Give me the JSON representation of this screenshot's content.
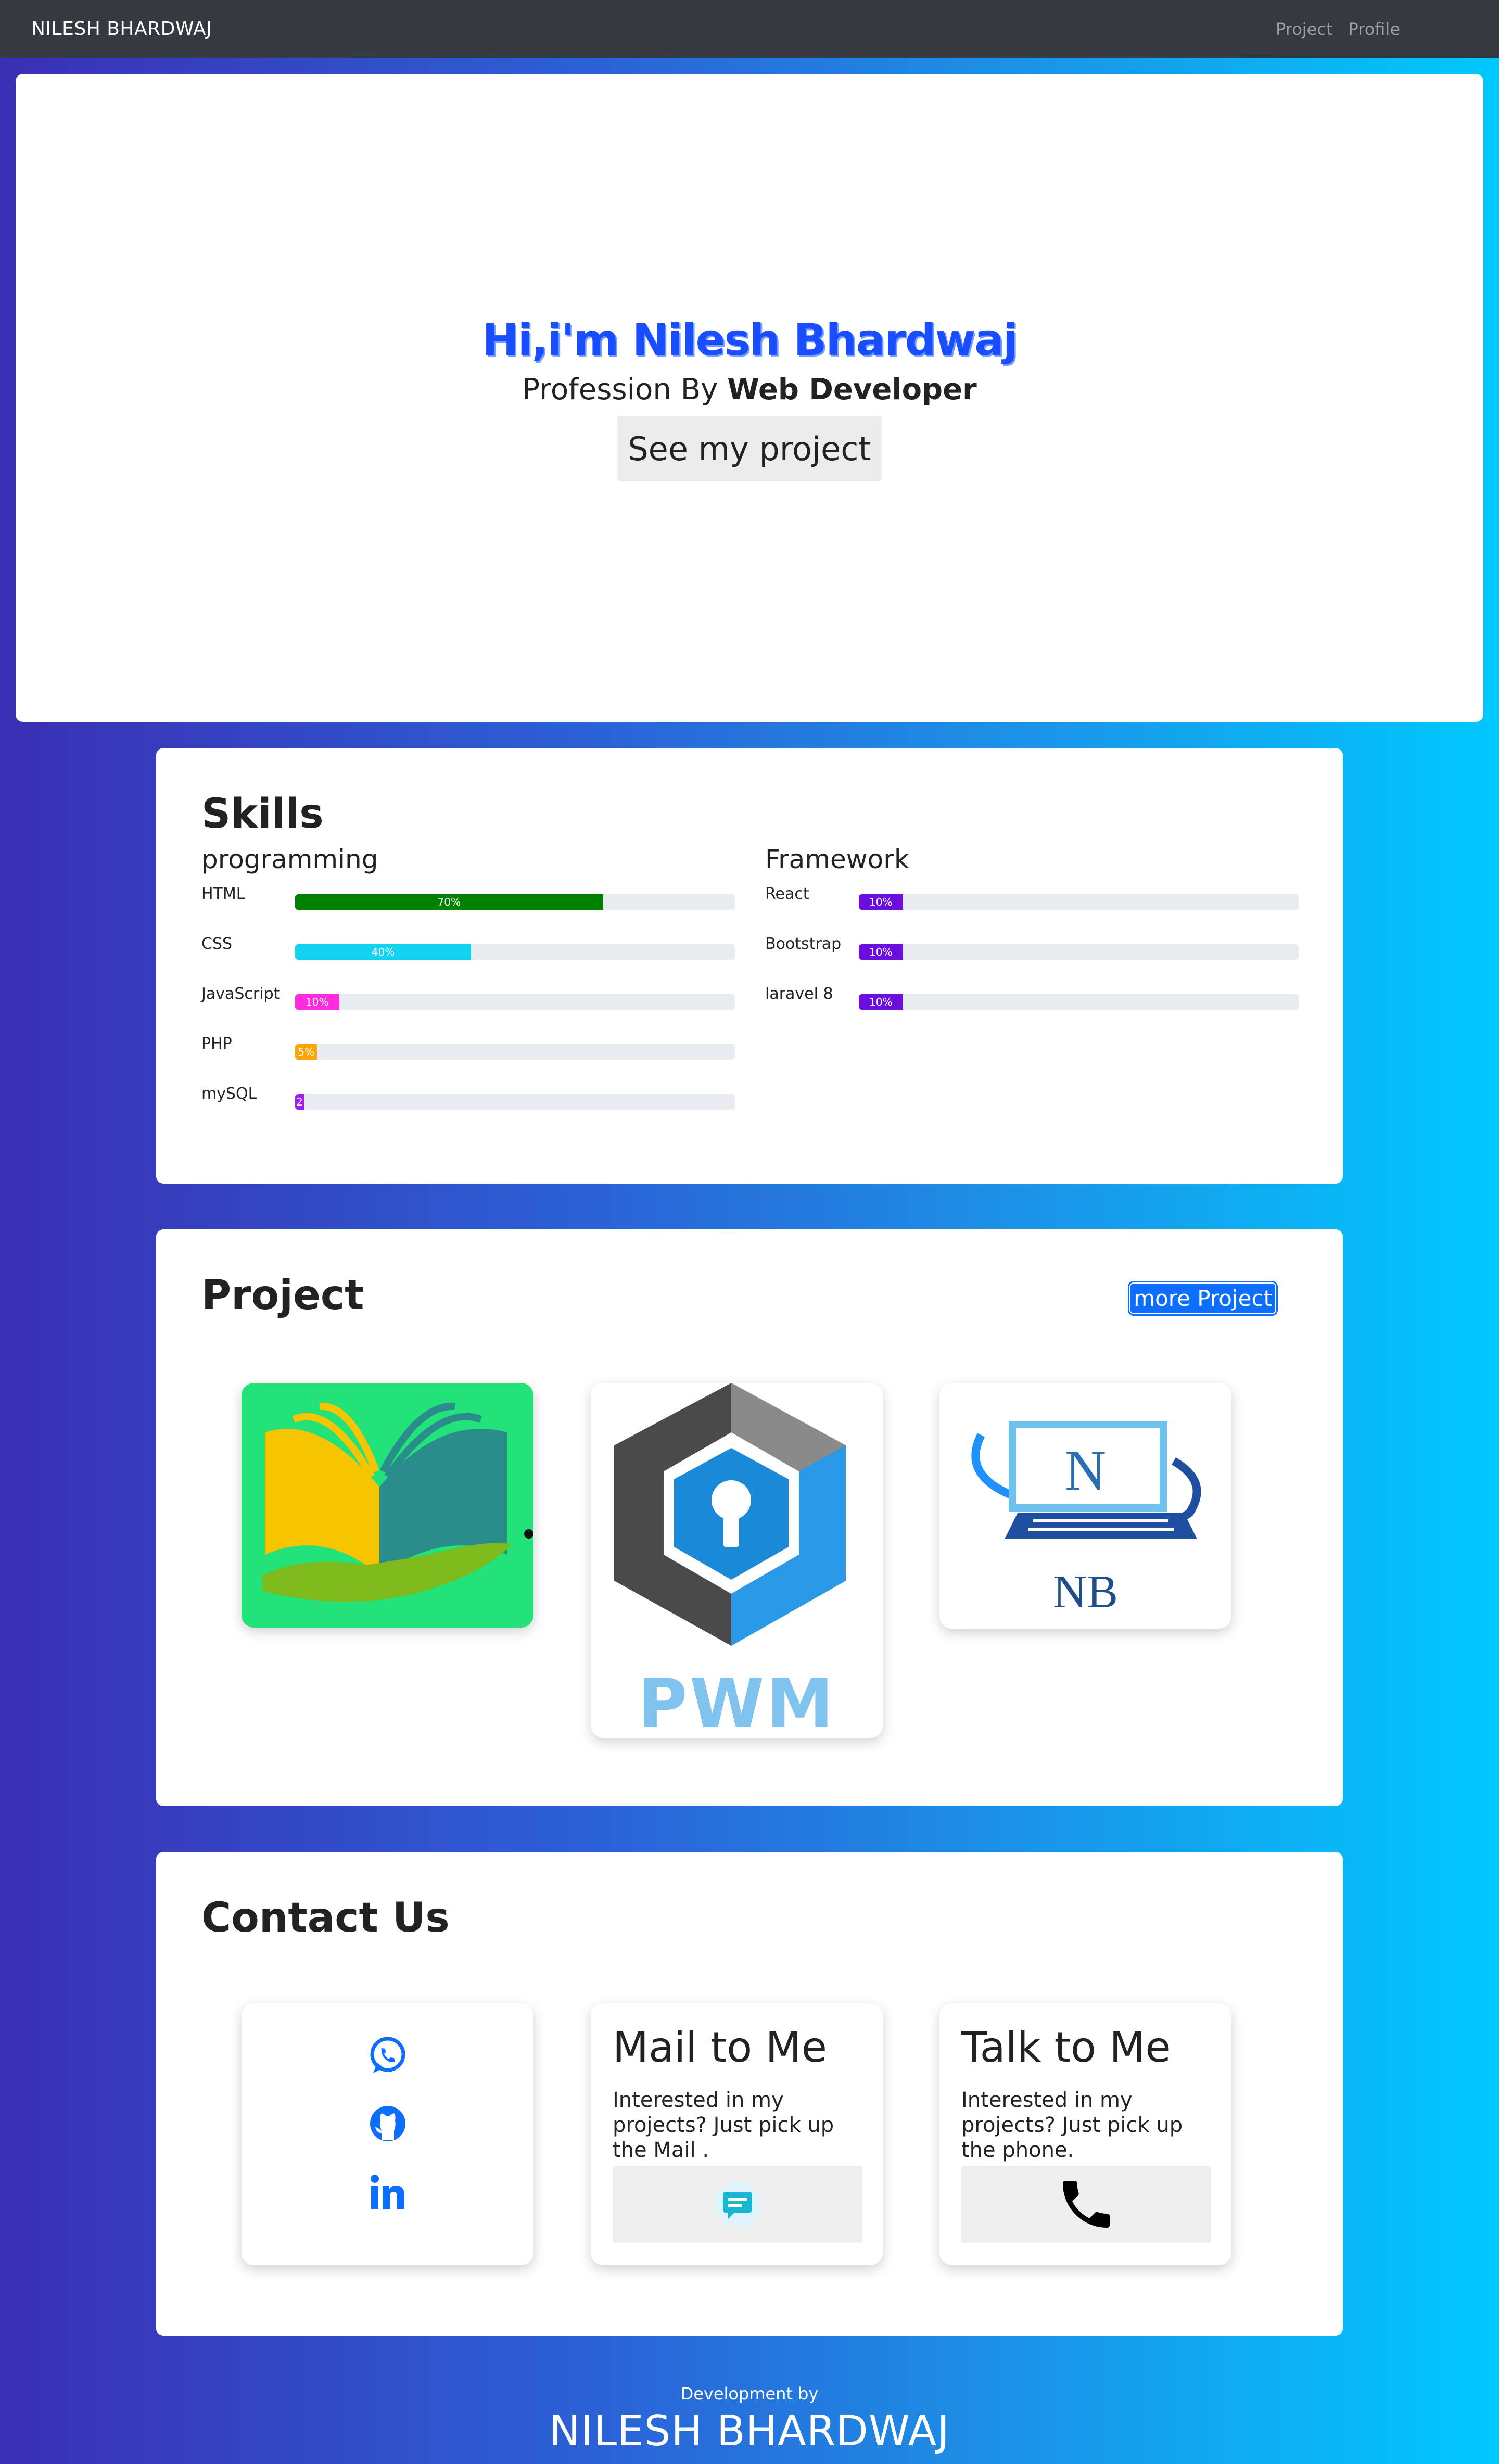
{
  "navbar": {
    "brand": "NILESH BHARDWAJ",
    "links": [
      {
        "label": "Project"
      },
      {
        "label": "Profile"
      }
    ]
  },
  "hero": {
    "title": "Hi,i'm Nilesh Bhardwaj",
    "subtitle_prefix": "Profession By ",
    "subtitle_bold": "Web Developer",
    "button": "See my project"
  },
  "skills": {
    "title": "Skills",
    "programming": {
      "heading": "programming",
      "items": [
        {
          "name": "HTML",
          "label": "70%",
          "value": 0.7,
          "color": "#008000"
        },
        {
          "name": "CSS",
          "label": "40%",
          "value": 0.4,
          "color": "#12d3f0"
        },
        {
          "name": "JavaScript",
          "label": "10%",
          "value": 0.1,
          "color": "#ff2bdc"
        },
        {
          "name": "PHP",
          "label": "5%",
          "value": 0.05,
          "color": "#ffa500"
        },
        {
          "name": "mySQL",
          "label": "2",
          "value": 0.02,
          "color": "#a020f0"
        }
      ]
    },
    "framework": {
      "heading": "Framework",
      "items": [
        {
          "name": "React",
          "label": "10%",
          "value": 0.1,
          "color": "#6a0dde"
        },
        {
          "name": "Bootstrap",
          "label": "10%",
          "value": 0.1,
          "color": "#6a0dde"
        },
        {
          "name": "laravel 8",
          "label": "10%",
          "value": 0.1,
          "color": "#6a0dde"
        }
      ]
    }
  },
  "project": {
    "title": "Project",
    "more_button": "more Project",
    "cards": [
      {
        "icon": "book-hand-logo-icon"
      },
      {
        "icon": "pwm-keyhole-logo-icon",
        "text": "PWM"
      },
      {
        "icon": "nb-computer-logo-icon",
        "text": "NB",
        "screen_letter": "N"
      }
    ]
  },
  "contact": {
    "title": "Contact Us",
    "social": [
      {
        "icon": "whatsapp-icon"
      },
      {
        "icon": "github-icon"
      },
      {
        "icon": "linkedin-icon"
      }
    ],
    "mail": {
      "heading": "Mail to Me",
      "text": "Interested in my projects? Just pick up the Mail .",
      "icon": "chat-message-icon"
    },
    "phone": {
      "heading": "Talk to Me",
      "text": "Interested in my projects? Just pick up the phone.",
      "icon": "phone-icon"
    }
  },
  "footer": {
    "small": "Development by",
    "big": "NILESH BHARDWAJ"
  },
  "colors": {
    "accent": "#0d6efd",
    "navbar": "#343a40",
    "hero_title": "#1a4dff"
  }
}
